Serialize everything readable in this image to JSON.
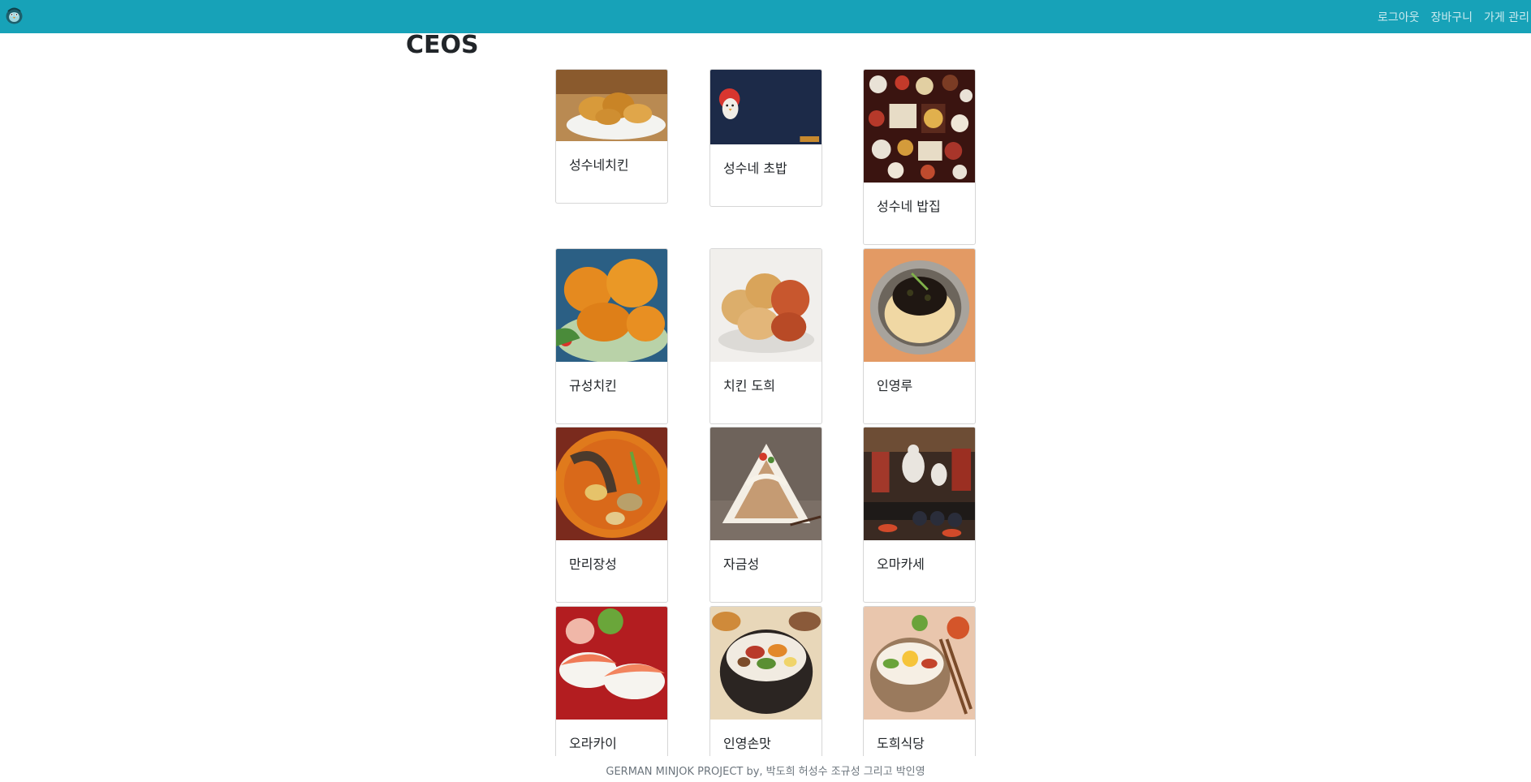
{
  "navbar": {
    "logo_icon": "penguin-logo-icon",
    "links": [
      "로그아웃",
      "장바구니",
      "가게 관리"
    ],
    "bg_color": "#17a2b8"
  },
  "page": {
    "title": "CEOS"
  },
  "stores": [
    {
      "name": "성수네치킨",
      "image": "fried-chicken-plate"
    },
    {
      "name": "성수네 초밥",
      "image": "penguin-illustration"
    },
    {
      "name": "성수네 밥집",
      "image": "korean-table-spread"
    },
    {
      "name": "규성치킨",
      "image": "crispy-fried-chicken"
    },
    {
      "name": "치킨 도희",
      "image": "fried-chicken-bowl"
    },
    {
      "name": "인영루",
      "image": "jajangmyeon"
    },
    {
      "name": "만리장성",
      "image": "spicy-stew"
    },
    {
      "name": "자금성",
      "image": "noodle-salad"
    },
    {
      "name": "오마카세",
      "image": "conveyor-sushi-restaurant"
    },
    {
      "name": "오라카이",
      "image": "salmon-sushi"
    },
    {
      "name": "인영손맛",
      "image": "dolsot-bibimbap"
    },
    {
      "name": "도희식당",
      "image": "bibimbap-bowl"
    }
  ],
  "footer": {
    "text": "GERMAN MINJOK PROJECT by, 박도희 허성수 조규성 그리고 박인영"
  }
}
